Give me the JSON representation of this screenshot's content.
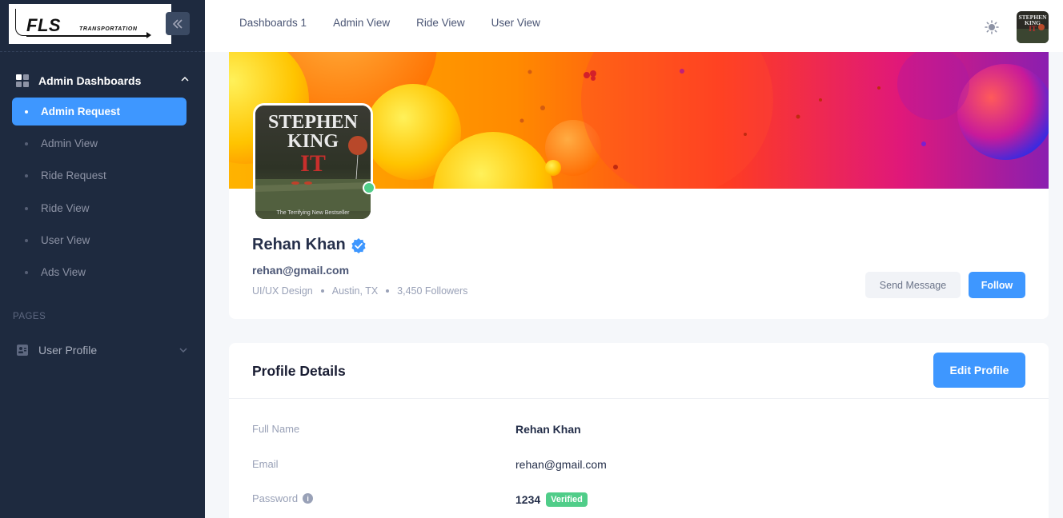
{
  "brand": {
    "logo_main": "FLS",
    "logo_sub": "TRANSPORTATION"
  },
  "sidebar": {
    "section_title": "Admin Dashboards",
    "items": [
      {
        "label": "Admin Request",
        "active": true
      },
      {
        "label": "Admin View"
      },
      {
        "label": "Ride Request"
      },
      {
        "label": "Ride View"
      },
      {
        "label": "User View"
      },
      {
        "label": "Ads View"
      }
    ],
    "pages_label": "PAGES",
    "user_profile_label": "User Profile"
  },
  "topnav": {
    "items": [
      "Dashboards 1",
      "Admin View",
      "Ride View",
      "User View"
    ]
  },
  "profile": {
    "name": "Rehan Khan",
    "email": "rehan@gmail.com",
    "role": "UI/UX Design",
    "location": "Austin, TX",
    "followers": "3,450 Followers",
    "send_message": "Send Message",
    "follow": "Follow",
    "avatar_text": {
      "line1": "STEPHEN",
      "line2": "KING",
      "line3": "IT",
      "tagline": "The Terrifying New Bestseller"
    }
  },
  "details": {
    "title": "Profile Details",
    "edit_button": "Edit Profile",
    "rows": [
      {
        "label": "Full Name",
        "value": "Rehan Khan"
      },
      {
        "label": "Email",
        "value": "rehan@gmail.com"
      },
      {
        "label": "Password",
        "value": "1234",
        "badge": "Verified"
      }
    ]
  },
  "colors": {
    "primary": "#3e97ff",
    "sidebar": "#1e2a3f",
    "success": "#50cd89"
  }
}
